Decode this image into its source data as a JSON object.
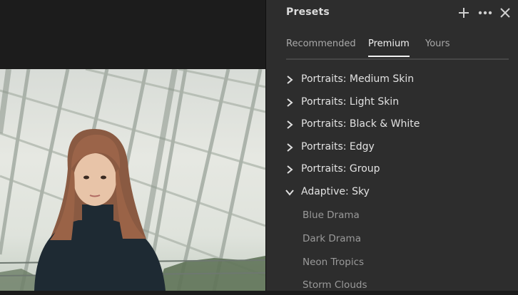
{
  "panel": {
    "title": "Presets",
    "icons": [
      "add-icon",
      "more-icon",
      "close-icon"
    ]
  },
  "tabs": [
    {
      "label": "Recommended",
      "active": false
    },
    {
      "label": "Premium",
      "active": true
    },
    {
      "label": "Yours",
      "active": false
    }
  ],
  "groups": [
    {
      "label": "Portraits: Medium Skin",
      "expanded": false
    },
    {
      "label": "Portraits: Light Skin",
      "expanded": false
    },
    {
      "label": "Portraits: Black & White",
      "expanded": false
    },
    {
      "label": "Portraits: Edgy",
      "expanded": false
    },
    {
      "label": "Portraits: Group",
      "expanded": false
    },
    {
      "label": "Adaptive: Sky",
      "expanded": true
    }
  ],
  "presets": [
    {
      "label": "Blue Drama"
    },
    {
      "label": "Dark Drama"
    },
    {
      "label": "Neon Tropics"
    },
    {
      "label": "Storm Clouds"
    }
  ],
  "colors": {
    "panel_bg": "#2d2d2d",
    "group_text": "#e2e2e2",
    "preset_text": "#9a9a9a",
    "active_tab": "#f2f2f2"
  }
}
